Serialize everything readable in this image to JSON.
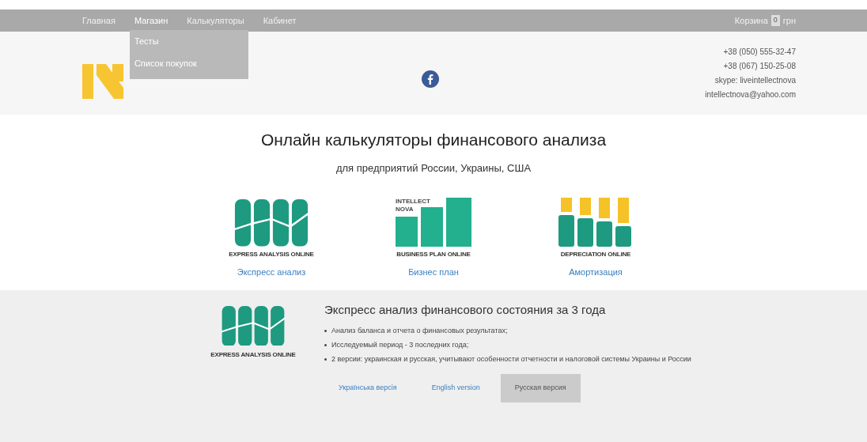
{
  "nav": {
    "items": [
      {
        "label": "Главная",
        "expanded": false
      },
      {
        "label": "Магазин",
        "expanded": true
      },
      {
        "label": "Калькуляторы",
        "expanded": false
      },
      {
        "label": "Кабинет",
        "expanded": false
      }
    ],
    "dropdown": [
      "Тесты",
      "Список покупок"
    ],
    "cart": {
      "label": "Корзина",
      "count": "0",
      "currency": "грн"
    }
  },
  "contacts": [
    "+38 (050) 555-32-47",
    "+38 (067) 150-25-08",
    "skype: liveintellectnova",
    "intellectnova@yahoo.com"
  ],
  "hero": {
    "title": "Онлайн калькуляторы финансового анализа",
    "subtitle": "для предприятий России, Украины, США"
  },
  "products": [
    {
      "kind": "express",
      "logo_text": "EXPRESS ANALYSIS ONLINE",
      "link": "Экспресс анализ"
    },
    {
      "kind": "business",
      "logo_text": "BUSINESS PLAN ONLINE",
      "logo_brand": "INTELLECT NOVA",
      "link": "Бизнес план"
    },
    {
      "kind": "depreciation",
      "logo_text": "DEPRECIATION ONLINE",
      "link": "Амортизация"
    }
  ],
  "detail": {
    "logo_text": "EXPRESS ANALYSIS ONLINE",
    "title": "Экспресс анализ финансового состояния за 3 года",
    "bullets": [
      "Анализ баланса и отчета о финансовых результатах;",
      "Исследуемый период - 3 последних года;",
      "2 версии: украинская и русская, учитывают особенности отчетности и налоговой системы Украины и России"
    ],
    "versions": [
      {
        "label": "Українська версія",
        "selected": false
      },
      {
        "label": "English version",
        "selected": false
      },
      {
        "label": "Русская версия",
        "selected": true
      }
    ]
  }
}
